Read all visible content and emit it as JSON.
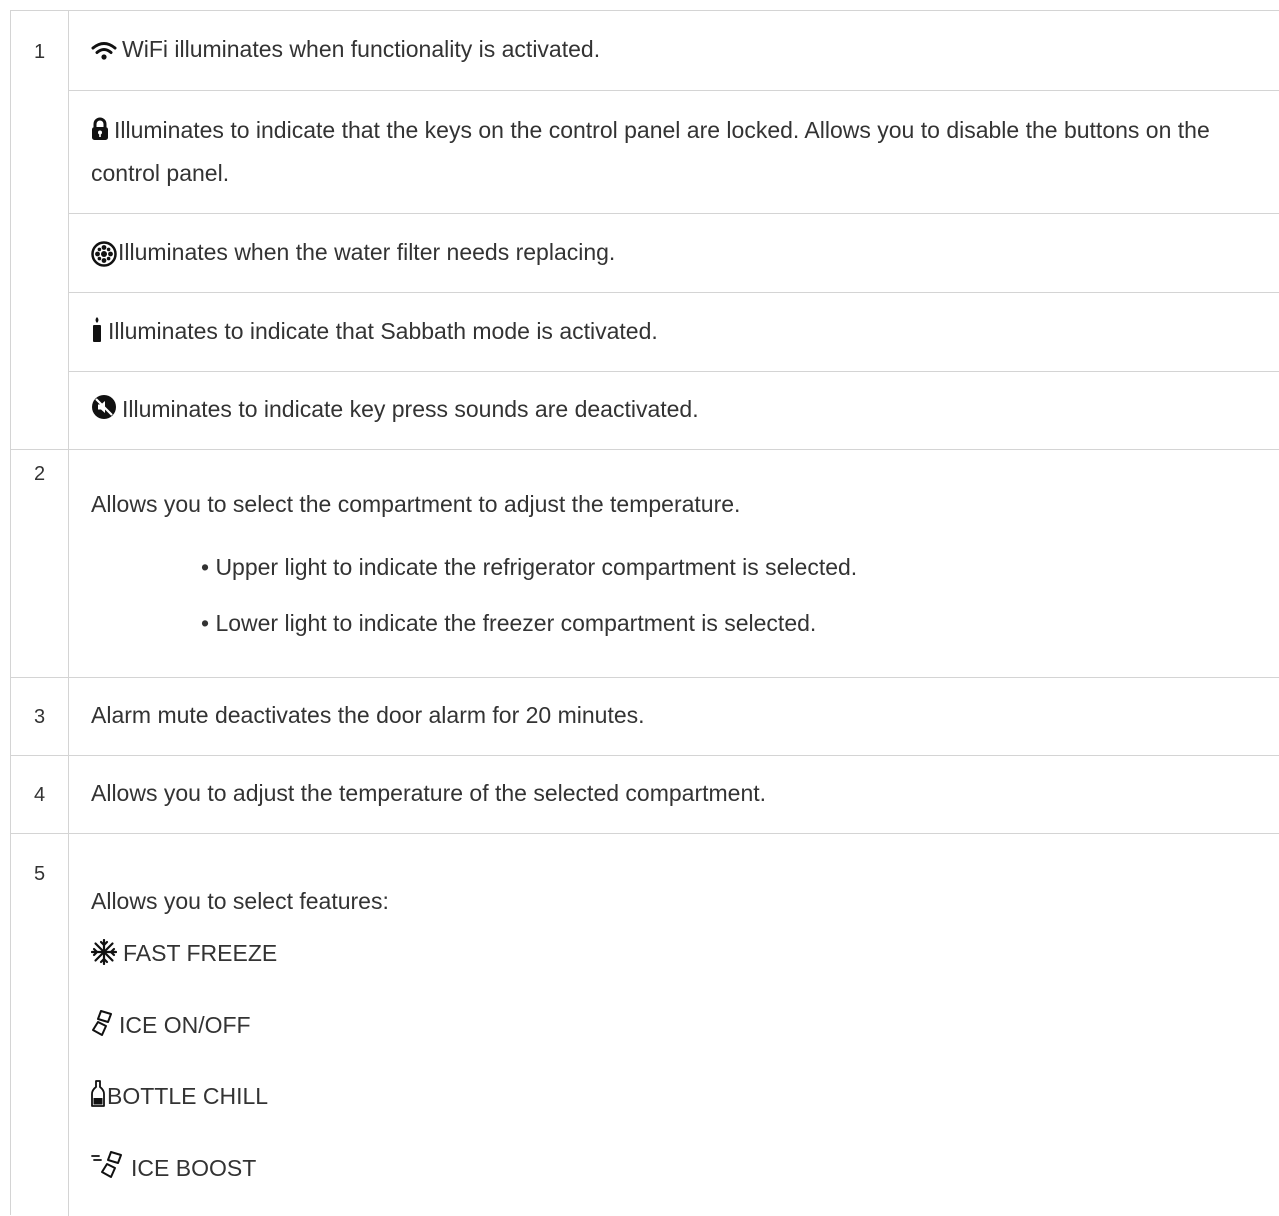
{
  "rows": [
    {
      "number": "1",
      "items": [
        {
          "icon": "wifi-icon",
          "text": "WiFi illuminates when functionality is activated."
        },
        {
          "icon": "lock-icon",
          "text": "Illuminates to indicate that the keys on the control panel are locked. Allows you to disable the buttons on the control panel."
        },
        {
          "icon": "water-filter-icon",
          "text": "Illuminates when the water filter needs replacing."
        },
        {
          "icon": "sabbath-candle-icon",
          "text": "Illuminates to indicate that Sabbath mode is activated."
        },
        {
          "icon": "sound-off-icon",
          "text": "Illuminates to indicate key press sounds are deactivated."
        }
      ]
    },
    {
      "number": "2",
      "text": "Allows you to select the compartment to adjust the temperature.",
      "bullets": [
        "• Upper light to indicate the refrigerator compartment is selected.",
        "• Lower light to indicate the freezer compartment is selected."
      ]
    },
    {
      "number": "3",
      "text": "Alarm mute deactivates the door alarm for 20 minutes."
    },
    {
      "number": "4",
      "text": "Allows you to adjust the temperature of the selected compartment."
    },
    {
      "number": "5",
      "text": "Allows you to select features:",
      "features": [
        {
          "icon": "snowflake-icon",
          "label": "FAST FREEZE"
        },
        {
          "icon": "ice-cube-icon",
          "label": "ICE ON/OFF"
        },
        {
          "icon": "bottle-icon",
          "label": "BOTTLE CHILL"
        },
        {
          "icon": "ice-boost-icon",
          "label": "ICE BOOST"
        }
      ]
    }
  ],
  "colors": {
    "border": "#d4d4d4",
    "text": "#333333",
    "icon": "#111111"
  }
}
